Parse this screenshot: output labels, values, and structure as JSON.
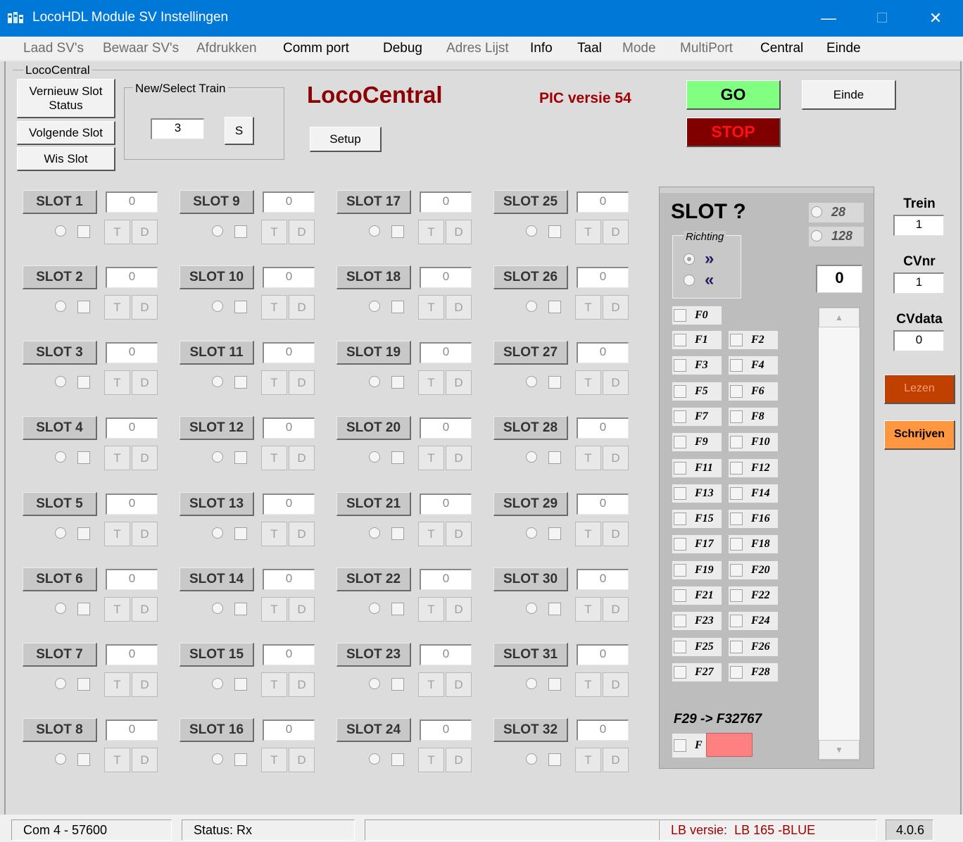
{
  "window": {
    "title": "LocoHDL Module SV Instellingen",
    "minimize": "—",
    "close": "✕"
  },
  "menu": [
    "Laad SV's",
    "Bewaar SV's",
    "Afdrukken",
    "Comm port",
    "Debug",
    "Adres Lijst",
    "Info",
    "Taal",
    "Mode",
    "MultiPort",
    "Central",
    "Einde"
  ],
  "menu_disabled": [
    true,
    true,
    true,
    false,
    false,
    true,
    false,
    false,
    true,
    true,
    false,
    false
  ],
  "group": {
    "title": "LocoCentral",
    "btn_refresh": "Vernieuw Slot Status",
    "btn_next": "Volgende Slot",
    "btn_clear": "Wis Slot",
    "train_group": "New/Select Train",
    "train_value": "3",
    "train_select": "S"
  },
  "heading": "LocoCentral",
  "setup": "Setup",
  "pic_version": "PIC versie 54",
  "go": "GO",
  "stop": "STOP",
  "exit": "Einde",
  "slot_labels": [
    "SLOT 1",
    "SLOT 2",
    "SLOT 3",
    "SLOT 4",
    "SLOT 5",
    "SLOT 6",
    "SLOT 7",
    "SLOT 8",
    "SLOT 9",
    "SLOT 10",
    "SLOT 11",
    "SLOT 12",
    "SLOT 13",
    "SLOT 14",
    "SLOT 15",
    "SLOT 16",
    "SLOT 17",
    "SLOT 18",
    "SLOT 19",
    "SLOT 20",
    "SLOT 21",
    "SLOT 22",
    "SLOT 23",
    "SLOT 24",
    "SLOT 25",
    "SLOT 26",
    "SLOT 27",
    "SLOT 28",
    "SLOT 29",
    "SLOT 30",
    "SLOT 31",
    "SLOT 32"
  ],
  "slot_values": [
    "0",
    "0",
    "0",
    "0",
    "0",
    "0",
    "0",
    "0",
    "0",
    "0",
    "0",
    "0",
    "0",
    "0",
    "0",
    "0",
    "0",
    "0",
    "0",
    "0",
    "0",
    "0",
    "0",
    "0",
    "0",
    "0",
    "0",
    "0",
    "0",
    "0",
    "0",
    "0"
  ],
  "slot_t": "T",
  "slot_d": "D",
  "panel": {
    "slot_title": "SLOT ?",
    "speed_28": "28",
    "speed_128": "128",
    "direction_group": "Richting",
    "dir_forward": "»",
    "dir_backward": "«",
    "speed_value": "0",
    "functions": [
      "F0",
      "F1",
      "F2",
      "F3",
      "F4",
      "F5",
      "F6",
      "F7",
      "F8",
      "F9",
      "F10",
      "F11",
      "F12",
      "F13",
      "F14",
      "F15",
      "F16",
      "F17",
      "F18",
      "F19",
      "F20",
      "F21",
      "F22",
      "F23",
      "F24",
      "F25",
      "F26",
      "F27",
      "F28"
    ],
    "ext_label": "F29 -> F32767",
    "ext_f": "F"
  },
  "side": {
    "train_label": "Trein",
    "train_value": "1",
    "cvnr_label": "CVnr",
    "cvnr_value": "1",
    "cvdata_label": "CVdata",
    "cvdata_value": "0",
    "read": "Lezen",
    "write": "Schrijven"
  },
  "status": {
    "port": "Com 4 - 57600",
    "state": "Status: Rx",
    "empty": "",
    "lb_label": "LB versie:",
    "lb_value": "LB 165 -BLUE",
    "version": "4.0.6"
  },
  "colors": {
    "titlebar": "#0078d7",
    "go": "#80ff80",
    "stop": "#800000",
    "read": "#c04000",
    "write": "#ff9640",
    "heading": "#8b0000",
    "f_ext": "#ff8080"
  }
}
